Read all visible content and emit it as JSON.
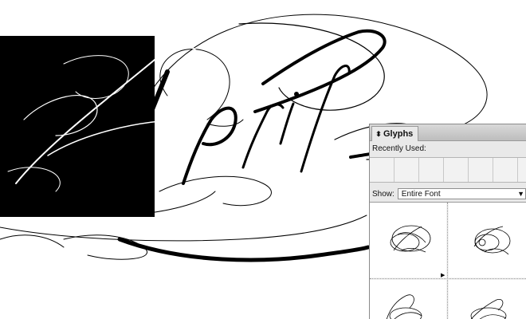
{
  "artwork": {
    "word": "April",
    "swash_icon": "ornamental-swash-lettering"
  },
  "glyphs_panel": {
    "title": "Glyphs",
    "tab_icon": "updown-arrows-icon",
    "recently_used_label": "Recently Used:",
    "recent_slots": 6,
    "show_label": "Show:",
    "show_value": "Entire Font",
    "glyphs": [
      {
        "name": "swash-A-glyph"
      },
      {
        "name": "swash-A-alt-glyph"
      },
      {
        "name": "swash-glyph-3"
      },
      {
        "name": "swash-glyph-4"
      }
    ]
  },
  "colors": {
    "ink": "#000000",
    "panel_bg": "#e9e9e9",
    "canvas_bg": "#ffffff"
  }
}
